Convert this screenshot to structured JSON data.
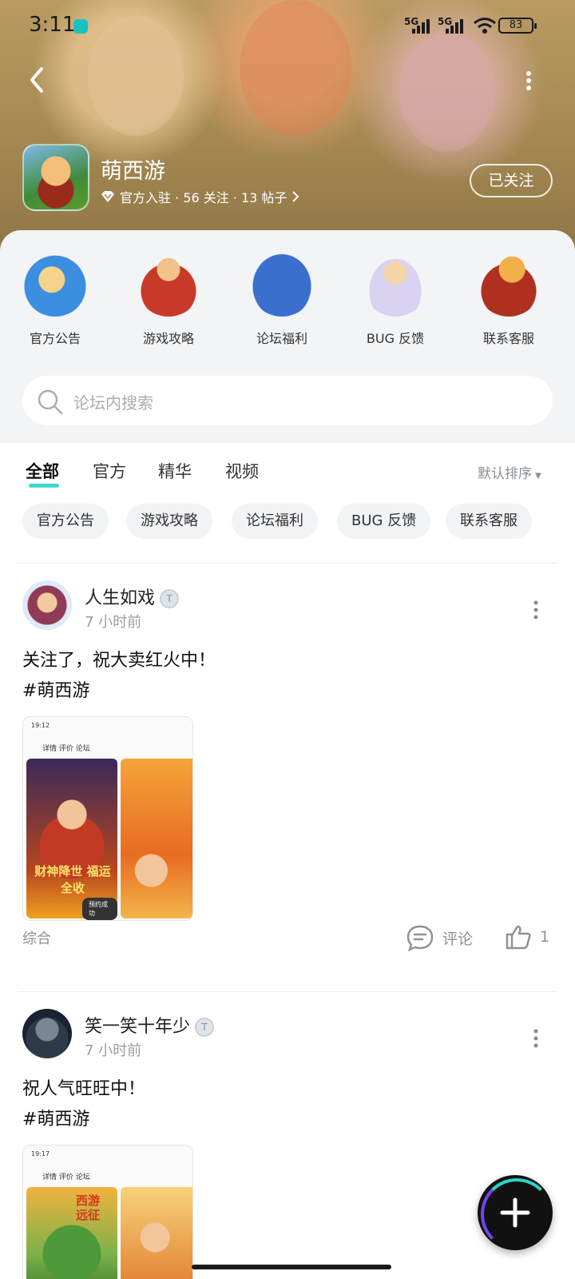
{
  "status_bar": {
    "time": "3:11",
    "sig1": "5G",
    "sig2": "5G",
    "battery": "83"
  },
  "header": {
    "game_name": "萌西游",
    "meta": "官方入驻 · 56 关注 · 13 帖子",
    "follow_label": "已关注"
  },
  "categories": [
    {
      "label": "官方公告"
    },
    {
      "label": "游戏攻略"
    },
    {
      "label": "论坛福利"
    },
    {
      "label": "BUG 反馈"
    },
    {
      "label": "联系客服"
    }
  ],
  "search": {
    "placeholder": "论坛内搜索"
  },
  "tabs": [
    {
      "label": "全部"
    },
    {
      "label": "官方"
    },
    {
      "label": "精华"
    },
    {
      "label": "视频"
    }
  ],
  "sort_label": "默认排序",
  "chips": [
    {
      "label": "官方公告"
    },
    {
      "label": "游戏攻略"
    },
    {
      "label": "论坛福利"
    },
    {
      "label": "BUG 反馈"
    },
    {
      "label": "联系客服"
    }
  ],
  "posts": [
    {
      "username": "人生如戏",
      "level": "T",
      "time": "7 小时前",
      "line1": "关注了，祝大卖红火中！",
      "line2": "#萌西游",
      "shot_time": "19:12",
      "shot_tabs": "详情  评价  论坛",
      "shot_title": "财神降世 福运全收",
      "shot_toast": "预约成功",
      "tag": "综合",
      "comment_label": "评论",
      "like_count": "1"
    },
    {
      "username": "笑一笑十年少",
      "level": "T",
      "time": "7 小时前",
      "line1": "祝人气旺旺中！",
      "line2": "#萌西游",
      "shot_time": "19:17",
      "shot_tabs": "详情  评价  论坛",
      "shot_title": "西游远征"
    }
  ],
  "colors": {
    "accent": "#1fd0c3",
    "panel_bg": "#f3f4f6",
    "banner": "#a98c55"
  }
}
